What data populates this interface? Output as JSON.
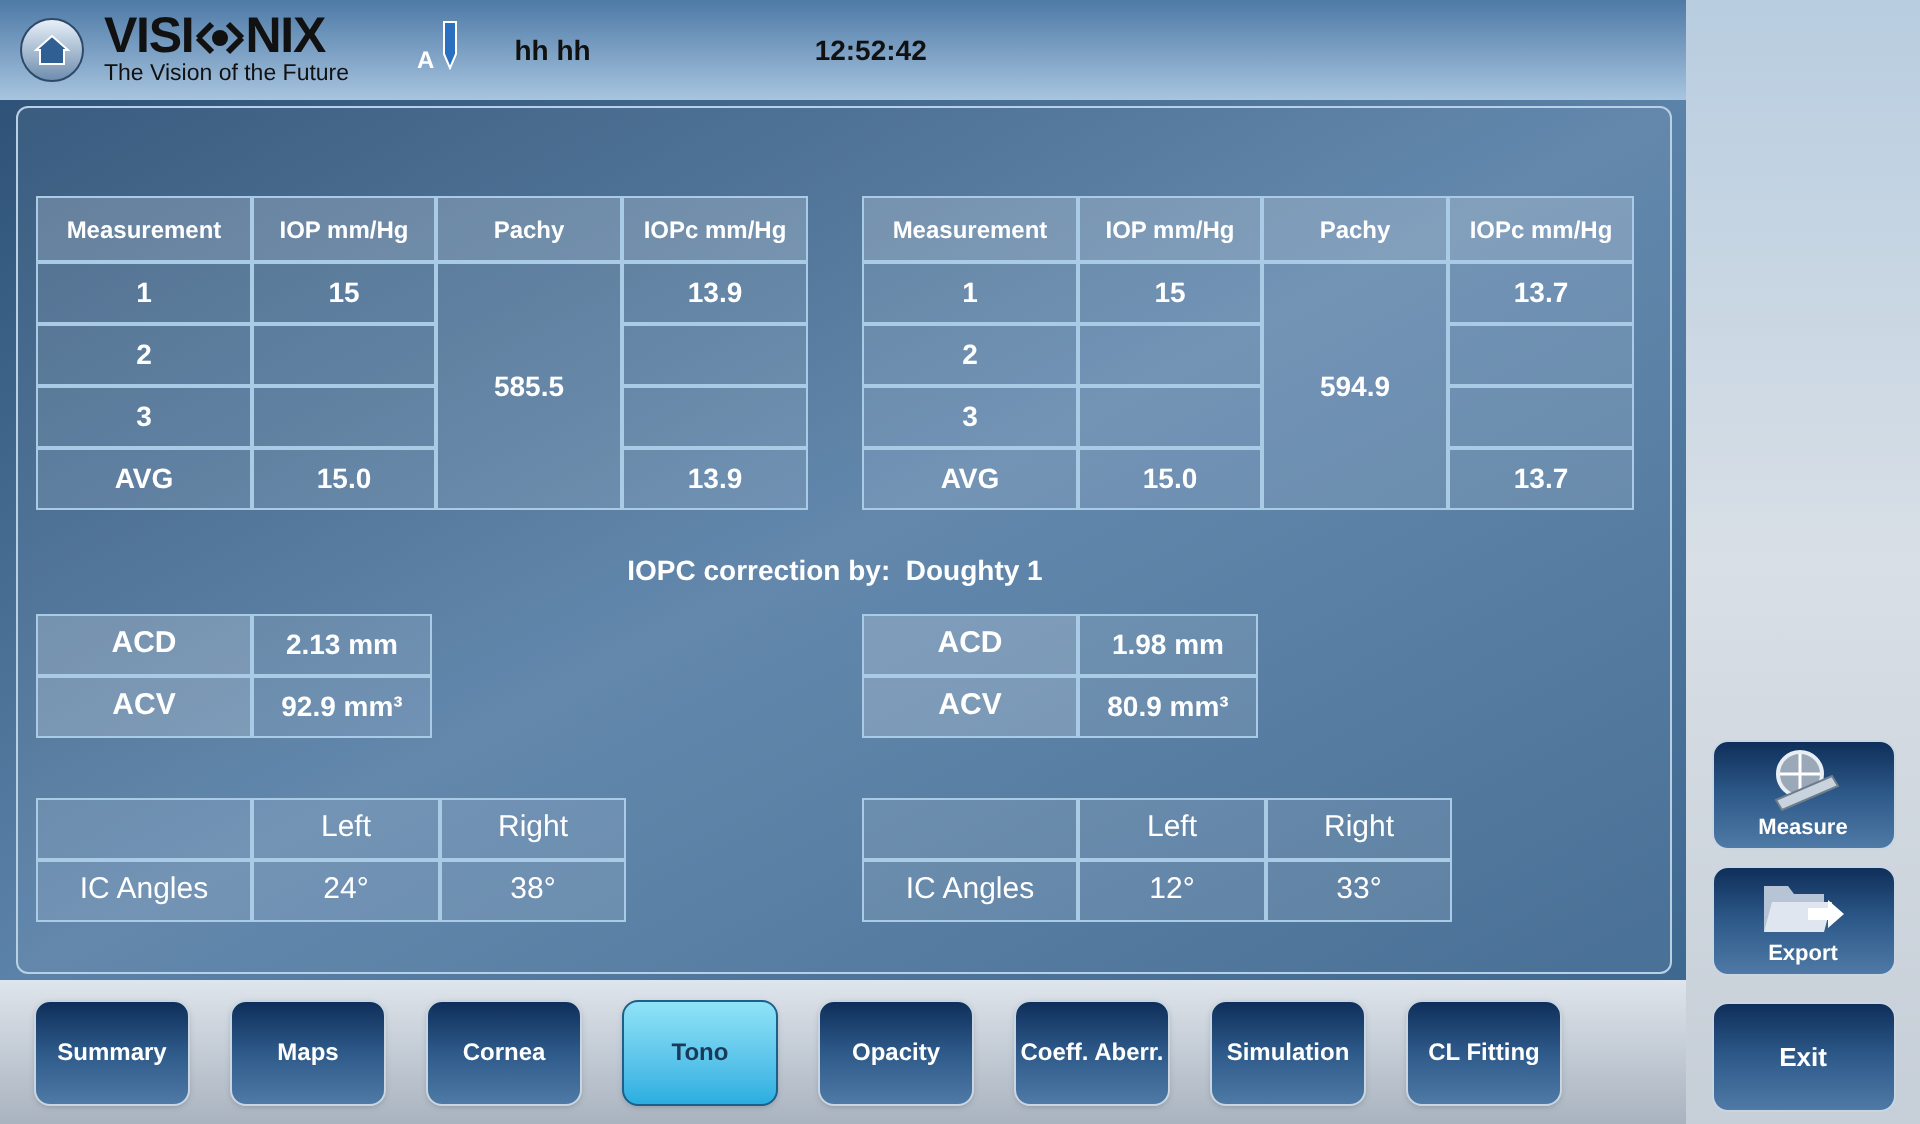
{
  "header": {
    "logo_left": "VISI",
    "logo_right": "NIX",
    "tagline": "The Vision of the Future",
    "operator": "A",
    "patient": "hh hh",
    "time": "12:52:42"
  },
  "eyes": [
    {
      "table": {
        "columns": [
          "Measurement",
          "IOP mm/Hg",
          "Pachy",
          "IOPc mm/Hg"
        ],
        "rows": [
          {
            "measurement": "1",
            "iop": "15",
            "iopc": "13.9"
          },
          {
            "measurement": "2"
          },
          {
            "measurement": "3"
          },
          {
            "measurement": "AVG",
            "iop": "15.0",
            "iopc": "13.9"
          }
        ],
        "pachy": "585.5"
      },
      "chamber": [
        {
          "label": "ACD",
          "value": "2.13 mm"
        },
        {
          "label": "ACV",
          "value": "92.9 mm³"
        }
      ],
      "angles": {
        "columns": [
          "Left",
          "Right"
        ],
        "label": "IC Angles",
        "left": "24°",
        "right": "38°"
      }
    },
    {
      "table": {
        "columns": [
          "Measurement",
          "IOP mm/Hg",
          "Pachy",
          "IOPc mm/Hg"
        ],
        "rows": [
          {
            "measurement": "1",
            "iop": "15",
            "iopc": "13.7"
          },
          {
            "measurement": "2"
          },
          {
            "measurement": "3"
          },
          {
            "measurement": "AVG",
            "iop": "15.0",
            "iopc": "13.7"
          }
        ],
        "pachy": "594.9"
      },
      "chamber": [
        {
          "label": "ACD",
          "value": "1.98 mm"
        },
        {
          "label": "ACV",
          "value": "80.9 mm³"
        }
      ],
      "angles": {
        "columns": [
          "Left",
          "Right"
        ],
        "label": "IC Angles",
        "left": "12°",
        "right": "33°"
      }
    }
  ],
  "correction": "IOPC correction by:  Doughty 1",
  "tabs": [
    {
      "label": "Summary",
      "selected": false
    },
    {
      "label": "Maps",
      "selected": false
    },
    {
      "label": "Cornea",
      "selected": false
    },
    {
      "label": "Tono",
      "selected": true
    },
    {
      "label": "Opacity",
      "selected": false
    },
    {
      "label": "Coeff. Aberr.",
      "selected": false
    },
    {
      "label": "Simulation",
      "selected": false
    },
    {
      "label": "CL Fitting",
      "selected": false
    }
  ],
  "side_buttons": [
    {
      "label": "Measure",
      "kind": "measure"
    },
    {
      "label": "Export",
      "kind": "export"
    }
  ],
  "exit": "Exit"
}
